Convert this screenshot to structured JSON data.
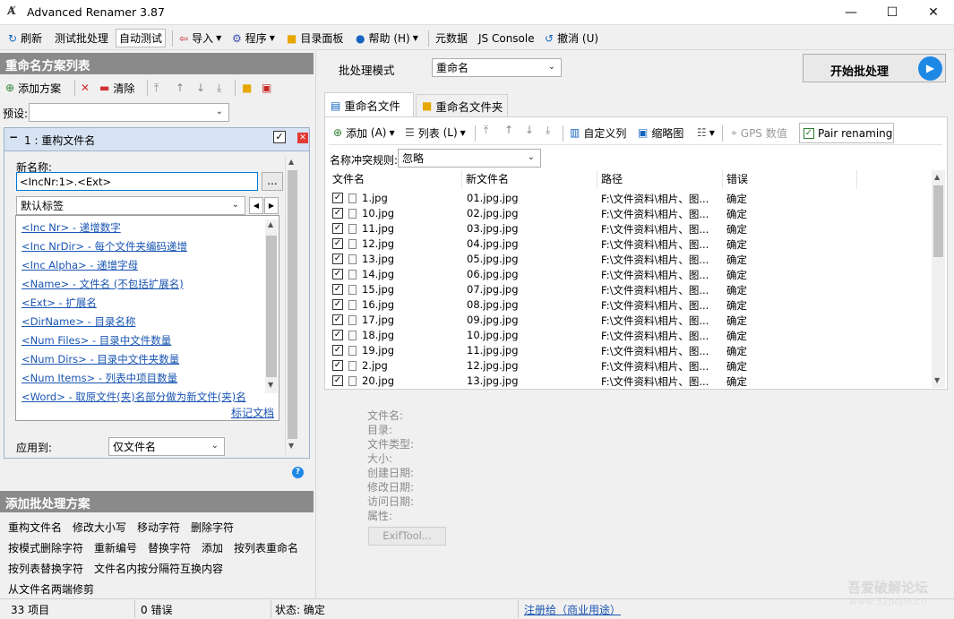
{
  "window": {
    "title": "Advanced Renamer 3.87",
    "minimize": "—",
    "maximize": "☐",
    "close": "✕"
  },
  "toolbar": {
    "refresh": "刷新",
    "test_batch": "测试批处理",
    "auto_test": "自动测试",
    "import": "导入",
    "program": "程序",
    "dir_panel": "目录面板",
    "help": "帮助",
    "help_key": "(H)",
    "metadata": "元数据",
    "js_console": "JS Console",
    "undo": "撤消",
    "undo_key": "(U)"
  },
  "left": {
    "header": "重命名方案列表",
    "add_method": "添加方案",
    "clear": "清除",
    "preset_label": "预设:",
    "preset_value": "",
    "method": {
      "title": "1 : 重构文件名",
      "new_name_label": "新名称:",
      "new_name_value": "<IncNr:1>.<Ext>",
      "browse": "...",
      "tag_group": "默认标签",
      "tags": [
        "<Inc Nr> - 递增数字",
        "<Inc NrDir> - 每个文件夹编码递增",
        "<Inc Alpha> - 递增字母",
        "<Name> - 文件名 (不包括扩展名)",
        "<Ext> - 扩展名",
        "<DirName> - 目录名称",
        "<Num Files> - 目录中文件数量",
        "<Num Dirs> - 目录中文件夹数量",
        "<Num Items> - 列表中项目数量",
        "<Word> - 取原文件(夹)名部分做为新文件(夹)名"
      ],
      "doc_link": "标记文档",
      "apply_label": "应用到:",
      "apply_value": "仅文件名",
      "help": "?"
    },
    "add_header": "添加批处理方案",
    "methods_row1": [
      "重构文件名",
      "修改大小写",
      "移动字符",
      "删除字符"
    ],
    "methods_row2": [
      "按模式删除字符",
      "重新编号",
      "替换字符",
      "添加",
      "按列表重命名"
    ],
    "methods_row3": [
      "按列表替换字符",
      "文件名内按分隔符互换内容"
    ],
    "methods_row4": [
      "从文件名两端修剪"
    ]
  },
  "right": {
    "batch_mode_label": "批处理模式",
    "batch_mode_value": "重命名",
    "start": "开始批处理",
    "tab_files": "重命名文件",
    "tab_folders": "重命名文件夹",
    "ftb": {
      "add": "添加",
      "add_key": "(A)",
      "list": "列表",
      "list_key": "(L)",
      "custom_cols": "自定义列",
      "thumbs": "缩略图",
      "gps": "GPS 数值",
      "pair": "Pair renaming"
    },
    "conflict_label": "名称冲突规则:",
    "conflict_value": "忽略",
    "columns": [
      "文件名",
      "新文件名",
      "路径",
      "错误"
    ],
    "rows": [
      {
        "name": "1.jpg",
        "new": "01.jpg.jpg",
        "path": "F:\\文件资料\\相片、图...",
        "err": "确定"
      },
      {
        "name": "10.jpg",
        "new": "02.jpg.jpg",
        "path": "F:\\文件资料\\相片、图...",
        "err": "确定"
      },
      {
        "name": "11.jpg",
        "new": "03.jpg.jpg",
        "path": "F:\\文件资料\\相片、图...",
        "err": "确定"
      },
      {
        "name": "12.jpg",
        "new": "04.jpg.jpg",
        "path": "F:\\文件资料\\相片、图...",
        "err": "确定"
      },
      {
        "name": "13.jpg",
        "new": "05.jpg.jpg",
        "path": "F:\\文件资料\\相片、图...",
        "err": "确定"
      },
      {
        "name": "14.jpg",
        "new": "06.jpg.jpg",
        "path": "F:\\文件资料\\相片、图...",
        "err": "确定"
      },
      {
        "name": "15.jpg",
        "new": "07.jpg.jpg",
        "path": "F:\\文件资料\\相片、图...",
        "err": "确定"
      },
      {
        "name": "16.jpg",
        "new": "08.jpg.jpg",
        "path": "F:\\文件资料\\相片、图...",
        "err": "确定"
      },
      {
        "name": "17.jpg",
        "new": "09.jpg.jpg",
        "path": "F:\\文件资料\\相片、图...",
        "err": "确定"
      },
      {
        "name": "18.jpg",
        "new": "10.jpg.jpg",
        "path": "F:\\文件资料\\相片、图...",
        "err": "确定"
      },
      {
        "name": "19.jpg",
        "new": "11.jpg.jpg",
        "path": "F:\\文件资料\\相片、图...",
        "err": "确定"
      },
      {
        "name": "2.jpg",
        "new": "12.jpg.jpg",
        "path": "F:\\文件资料\\相片、图...",
        "err": "确定"
      },
      {
        "name": "20.jpg",
        "new": "13.jpg.jpg",
        "path": "F:\\文件资料\\相片、图...",
        "err": "确定"
      }
    ],
    "props": [
      "文件名:",
      "目录:",
      "文件类型:",
      "大小:",
      "创建日期:",
      "修改日期:",
      "访问日期:",
      "属性:"
    ],
    "exiftool": "ExifTool..."
  },
  "status": {
    "items": "33 项目",
    "errors": "0 错误",
    "state": "状态: 确定",
    "register": "注册给（商业用途）"
  },
  "watermark": {
    "line1": "吾爱破解论坛",
    "line2": "www.52pojie.cn"
  },
  "colors": {
    "accent": "#1e88e5",
    "header_bg": "#8a8a8a",
    "link": "#1a55b2"
  }
}
